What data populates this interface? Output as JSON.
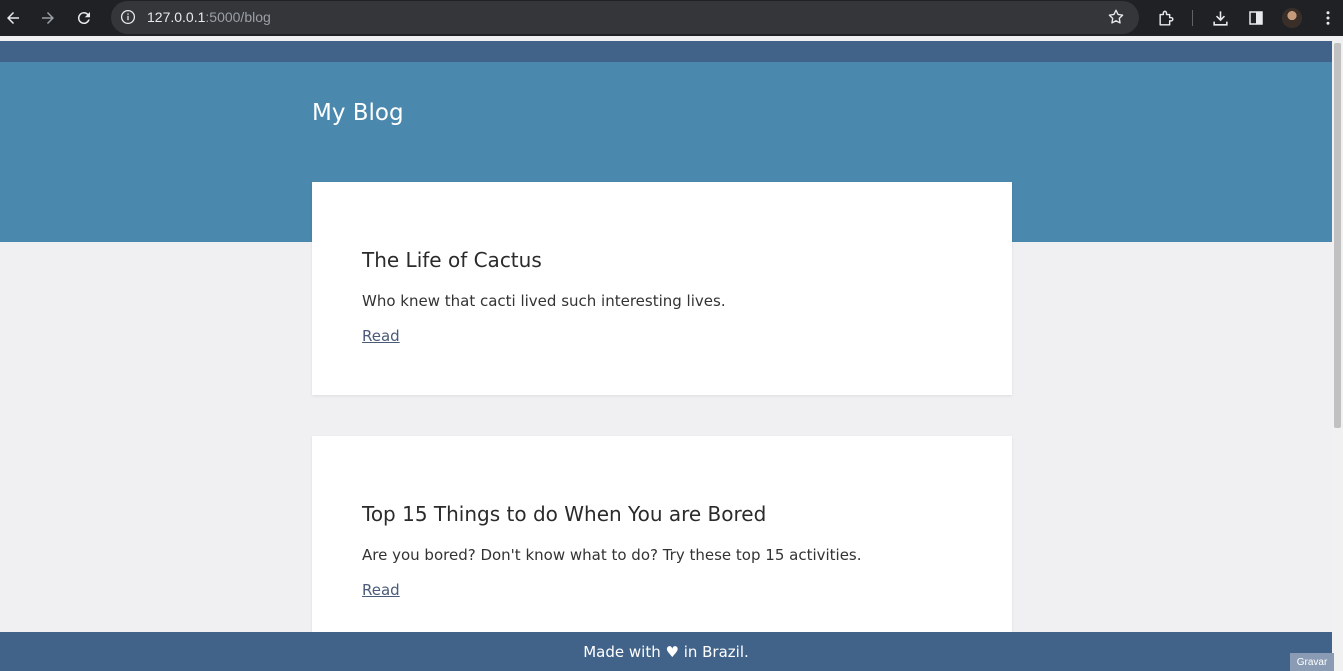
{
  "browser": {
    "url_host": "127.0.0.1",
    "url_path": ":5000/blog"
  },
  "site": {
    "title": "My Blog"
  },
  "posts": [
    {
      "title": "The Life of Cactus",
      "excerpt": "Who knew that cacti lived such interesting lives.",
      "link_label": "Read"
    },
    {
      "title": "Top 15 Things to do When You are Bored",
      "excerpt": "Are you bored? Don't know what to do? Try these top 15 activities.",
      "link_label": "Read"
    }
  ],
  "footer": {
    "text": "Made with ♥ in Brazil."
  },
  "overlay": {
    "label": "Gravar"
  },
  "colors": {
    "topbar": "#41638a",
    "hero": "#4b88ae",
    "background": "#f0f0f2",
    "card": "#ffffff"
  }
}
